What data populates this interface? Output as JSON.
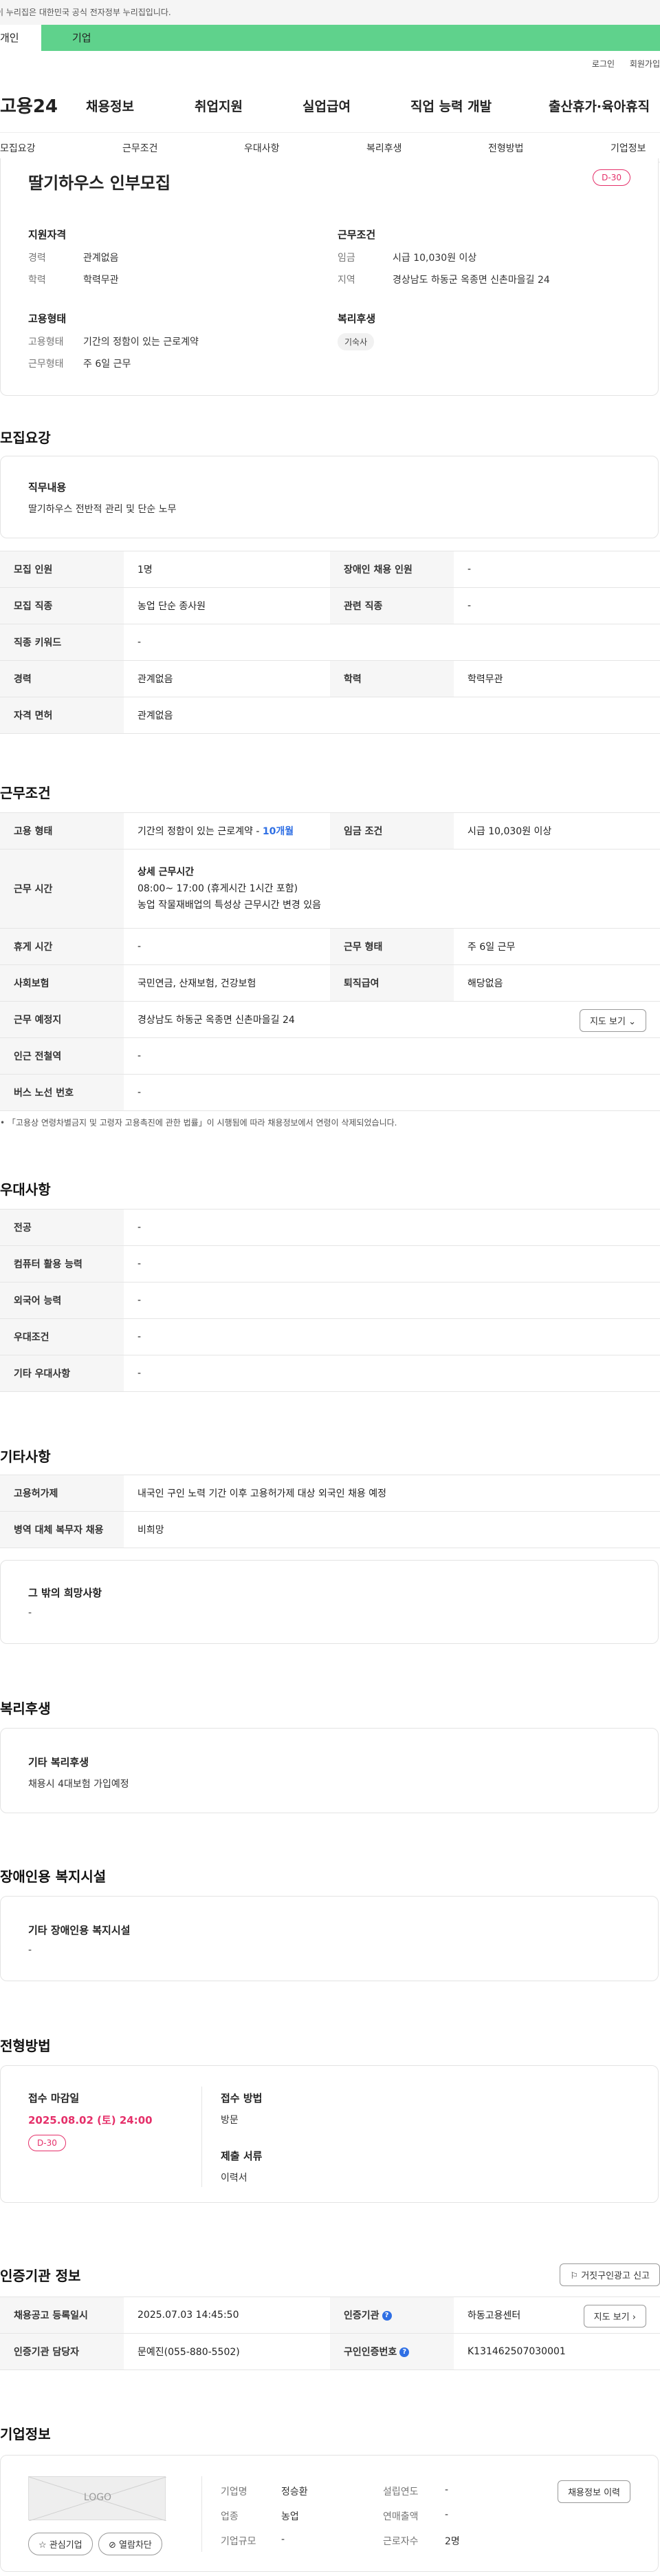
{
  "gov_banner": "이 누리집은 대한민국 공식 전자정부 누리집입니다.",
  "user_tabs": {
    "personal": "개인",
    "company": "기업"
  },
  "util": {
    "login": "로그인",
    "join": "회원가입"
  },
  "gnb": {
    "logo": "고용24",
    "items": [
      "채용정보",
      "취업지원",
      "실업급여",
      "직업 능력 개발",
      "출산휴가·육아휴직"
    ]
  },
  "subnav": [
    "모집요강",
    "근무조건",
    "우대사항",
    "복리후생",
    "전형방법",
    "기업정보"
  ],
  "summary": {
    "title": "딸기하우스 인부모집",
    "dday": "D-30",
    "qual_title": "지원자격",
    "career_label": "경력",
    "career_value": "관계없음",
    "edu_label": "학력",
    "edu_value": "학력무관",
    "emp_title": "고용형태",
    "emptype_label": "고용형태",
    "emptype_value": "기간의 정함이 있는 근로계약",
    "workform_label": "근무형태",
    "workform_value": "주 6일 근무",
    "cond_title": "근무조건",
    "wage_label": "임금",
    "wage_value": "시급 10,030원 이상",
    "region_label": "지역",
    "region_value": "경상남도 하동군 옥종면 신촌마을길 24",
    "welfare_title": "복리후생",
    "welfare_chip": "기숙사"
  },
  "recruit": {
    "section_title": "모집요강",
    "duty_title": "직무내용",
    "duty_value": "딸기하우스 전반적 관리 및 단순 노무",
    "rows": [
      {
        "l1": "모집 인원",
        "v1": "1명",
        "l2": "장애인 채용 인원",
        "v2": "-"
      },
      {
        "l1": "모집 직종",
        "v1": "농업 단순 종사원",
        "l2": "관련 직종",
        "v2": "-"
      },
      {
        "l1": "직종 키워드",
        "v1": "-"
      },
      {
        "l1": "경력",
        "v1": "관계없음",
        "l2": "학력",
        "v2": "학력무관"
      },
      {
        "l1": "자격 면허",
        "v1": "관계없음"
      }
    ]
  },
  "work": {
    "section_title": "근무조건",
    "emp_label": "고용 형태",
    "emp_value": "기간의 정함이 있는 근로계약 - ",
    "emp_months": "10개월",
    "wage_label": "임금 조건",
    "wage_value": "시급 10,030원 이상",
    "time_label": "근무 시간",
    "time_title": "상세 근무시간",
    "time_line1": "08:00~ 17:00 (휴게시간 1시간 포함)",
    "time_line2": "농업 작물재배업의 특성상 근무시간 변경 있음",
    "rest_label": "휴게 시간",
    "rest_value": "-",
    "form_label": "근무 형태",
    "form_value": "주 6일 근무",
    "ins_label": "사회보험",
    "ins_value": "국민연금, 산재보험, 건강보험",
    "sev_label": "퇴직급여",
    "sev_value": "해당없음",
    "place_label": "근무 예정지",
    "place_value": "경상남도 하동군 옥종면 신촌마을길 24",
    "map_button": "지도 보기",
    "station_label": "인근 전철역",
    "station_value": "-",
    "bus_label": "버스 노선 번호",
    "bus_value": "-",
    "note": "「고용상 연령차별금지 및 고령자 고용촉진에 관한 법률」이 시행됨에 따라 채용정보에서 연령이 삭제되었습니다."
  },
  "pref": {
    "section_title": "우대사항",
    "rows": [
      {
        "l": "전공",
        "v": "-"
      },
      {
        "l": "컴퓨터 활용 능력",
        "v": "-"
      },
      {
        "l": "외국어 능력",
        "v": "-"
      },
      {
        "l": "우대조건",
        "v": "-"
      },
      {
        "l": "기타 우대사항",
        "v": "-"
      }
    ]
  },
  "etc": {
    "section_title": "기타사항",
    "rows": [
      {
        "l": "고용허가제",
        "v": "내국인 구인 노력 기간 이후 고용허가제 대상 외국인 채용 예정"
      },
      {
        "l": "병역 대체 복무자 채용",
        "v": "비희망"
      }
    ],
    "other_title": "그 밖의 희망사항",
    "other_value": "-"
  },
  "welfare": {
    "section_title": "복리후생",
    "box_title": "기타 복리후생",
    "box_value": "채용시 4대보험 가입예정"
  },
  "disabled": {
    "section_title": "장애인용 복지시설",
    "box_title": "기타 장애인용 복지시설",
    "box_value": "-"
  },
  "selection": {
    "section_title": "전형방법",
    "deadline_title": "접수 마감일",
    "deadline_value": "2025.08.02 (토) 24:00",
    "dday": "D-30",
    "method_title": "접수 방법",
    "method_value": "방문",
    "docs_title": "제출 서류",
    "docs_value": "이력서"
  },
  "cert": {
    "section_title": "인증기관 정보",
    "report_button": "거짓구인광고 신고",
    "reg_label": "채용공고 등록일시",
    "reg_value": "2025.07.03 14:45:50",
    "org_label": "인증기관",
    "org_value": "하동고용센터",
    "map_button": "지도 보기",
    "manager_label": "인증기관 담당자",
    "manager_value": "문예진(055-880-5502)",
    "num_label": "구인인증번호",
    "num_value": "K131462507030001"
  },
  "company": {
    "section_title": "기업정보",
    "logo_text": "LOGO",
    "fav_button": "관심기업",
    "block_button": "열람차단",
    "history_button": "채용정보 이력",
    "name_label": "기업명",
    "name_value": "정승환",
    "ind_label": "업종",
    "ind_value": "농업",
    "size_label": "기업규모",
    "size_value": "-",
    "year_label": "설립연도",
    "year_value": "-",
    "sales_label": "연매출액",
    "sales_value": "-",
    "emp_label": "근로자수",
    "emp_value": "2명"
  }
}
